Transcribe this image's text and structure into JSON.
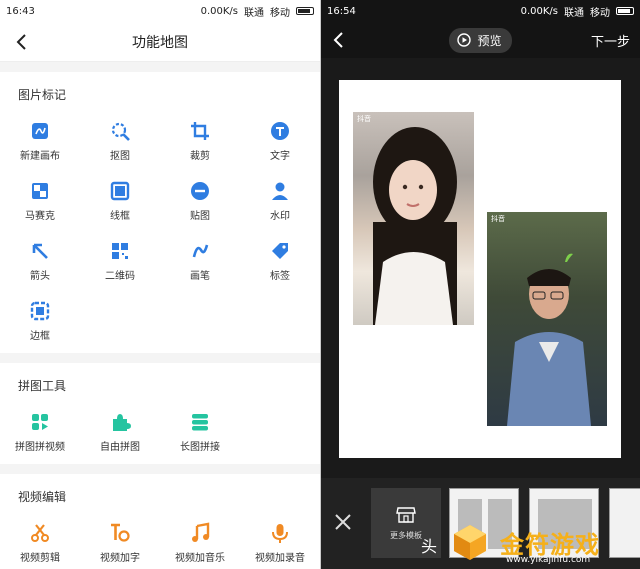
{
  "left": {
    "status": {
      "time": "16:43",
      "speed": "0.00K/s",
      "carrier1": "联通",
      "carrier2": "移动"
    },
    "title": "功能地图",
    "sections": [
      {
        "title": "图片标记",
        "items": [
          {
            "label": "新建画布",
            "icon": "canvas-icon",
            "color": "#2f7de1"
          },
          {
            "label": "抠图",
            "icon": "cutout-icon",
            "color": "#2f7de1"
          },
          {
            "label": "裁剪",
            "icon": "crop-icon",
            "color": "#2f7de1"
          },
          {
            "label": "文字",
            "icon": "text-icon",
            "color": "#2f7de1"
          },
          {
            "label": "马赛克",
            "icon": "mosaic-icon",
            "color": "#2f7de1"
          },
          {
            "label": "线框",
            "icon": "frame-icon",
            "color": "#2f7de1"
          },
          {
            "label": "贴图",
            "icon": "sticker-icon",
            "color": "#2f7de1"
          },
          {
            "label": "水印",
            "icon": "watermark-icon",
            "color": "#2f7de1"
          },
          {
            "label": "箭头",
            "icon": "arrow-icon",
            "color": "#2f7de1"
          },
          {
            "label": "二维码",
            "icon": "qrcode-icon",
            "color": "#2f7de1"
          },
          {
            "label": "画笔",
            "icon": "brush-icon",
            "color": "#2f7de1"
          },
          {
            "label": "标签",
            "icon": "tag-icon",
            "color": "#2f7de1"
          },
          {
            "label": "边框",
            "icon": "border-icon",
            "color": "#2f7de1"
          }
        ]
      },
      {
        "title": "拼图工具",
        "items": [
          {
            "label": "拼图拼视频",
            "icon": "collage-video-icon",
            "color": "#25c4a0"
          },
          {
            "label": "自由拼图",
            "icon": "puzzle-icon",
            "color": "#25c4a0"
          },
          {
            "label": "长图拼接",
            "icon": "long-image-icon",
            "color": "#25c4a0"
          }
        ]
      },
      {
        "title": "视频编辑",
        "items": [
          {
            "label": "视频剪辑",
            "icon": "scissors-icon",
            "color": "#f08a24"
          },
          {
            "label": "视频加字",
            "icon": "video-text-icon",
            "color": "#f08a24"
          },
          {
            "label": "视频加音乐",
            "icon": "music-icon",
            "color": "#f08a24"
          },
          {
            "label": "视频加录音",
            "icon": "mic-icon",
            "color": "#f08a24"
          }
        ]
      }
    ]
  },
  "right": {
    "status": {
      "time": "16:54",
      "speed": "0.00K/s",
      "carrier1": "联通",
      "carrier2": "移动"
    },
    "preview_label": "预览",
    "next_label": "下一步",
    "photo_watermark": "抖音",
    "photo_watermark_id": "ID:206514359",
    "more_templates_label": "更多模板",
    "cut_text": "头"
  },
  "watermark": {
    "brand": "金符游戏",
    "url": "www.yikajinfu.com"
  }
}
